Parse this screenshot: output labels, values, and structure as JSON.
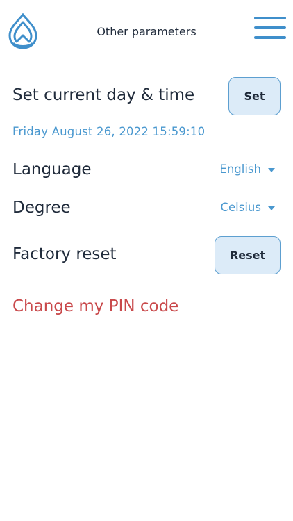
{
  "header": {
    "title": "Other parameters",
    "logo_icon": "water-drop-logo-icon",
    "menu_icon": "hamburger-menu-icon"
  },
  "datetime_row": {
    "label": "Set current day & time",
    "button_label": "Set",
    "current_value": "Friday August 26, 2022 15:59:10"
  },
  "language_row": {
    "label": "Language",
    "selected": "English"
  },
  "degree_row": {
    "label": "Degree",
    "selected": "Celsius"
  },
  "factory_reset_row": {
    "label": "Factory reset",
    "button_label": "Reset"
  },
  "pin_link": {
    "label": "Change my PIN code"
  },
  "colors": {
    "accent": "#4a98cf",
    "button_bg": "#dcebf8",
    "danger": "#c9494b",
    "text": "#1f2a3a"
  }
}
